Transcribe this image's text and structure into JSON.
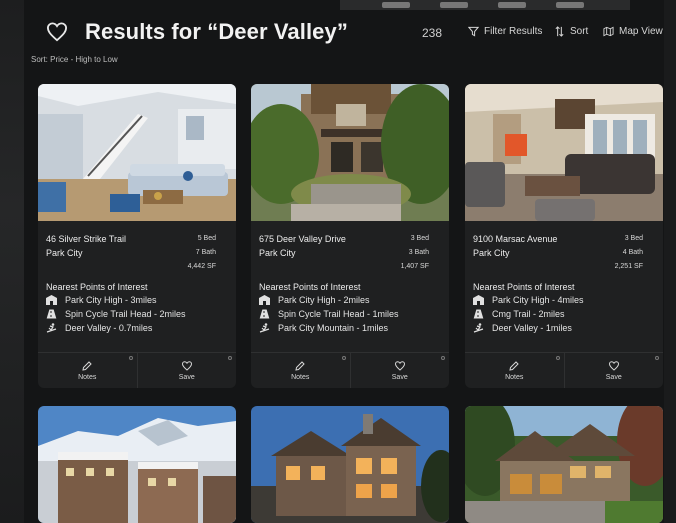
{
  "header": {
    "title": "Results for “Deer Valley”",
    "result_count": "238",
    "filter_label": "Filter Results",
    "sort_label": "Sort",
    "map_label": "Map View",
    "sort_line": "Sort: Price - High to Low"
  },
  "listings": [
    {
      "address": "46 Silver Strike Trail",
      "city": "Park City",
      "beds": "5 Bed",
      "baths": "7 Bath",
      "sqft": "4,442 SF",
      "poi_title": "Nearest Points of Interest",
      "pois": [
        {
          "icon": "school-icon",
          "text": "Park City High - 3miles"
        },
        {
          "icon": "trail-icon",
          "text": "Spin Cycle Trail Head - 2miles"
        },
        {
          "icon": "ski-icon",
          "text": "Deer Valley - 0.7miles"
        }
      ],
      "notes_label": "Notes",
      "save_label": "Save"
    },
    {
      "address": "675 Deer Valley Drive",
      "city": "Park City",
      "beds": "3 Bed",
      "baths": "3 Bath",
      "sqft": "1,407 SF",
      "poi_title": "Nearest Points of Interest",
      "pois": [
        {
          "icon": "school-icon",
          "text": "Park City High - 2miles"
        },
        {
          "icon": "trail-icon",
          "text": "Spin Cycle Trail Head - 1miles"
        },
        {
          "icon": "ski-icon",
          "text": "Park City Mountain - 1miles"
        }
      ],
      "notes_label": "Notes",
      "save_label": "Save"
    },
    {
      "address": "9100 Marsac Avenue",
      "city": "Park City",
      "beds": "3 Bed",
      "baths": "4 Bath",
      "sqft": "2,251 SF",
      "poi_title": "Nearest Points of Interest",
      "pois": [
        {
          "icon": "school-icon",
          "text": "Park City High - 4miles"
        },
        {
          "icon": "trail-icon",
          "text": "Cmg Trail - 2miles"
        },
        {
          "icon": "ski-icon",
          "text": "Deer Valley - 1miles"
        }
      ],
      "notes_label": "Notes",
      "save_label": "Save"
    }
  ]
}
